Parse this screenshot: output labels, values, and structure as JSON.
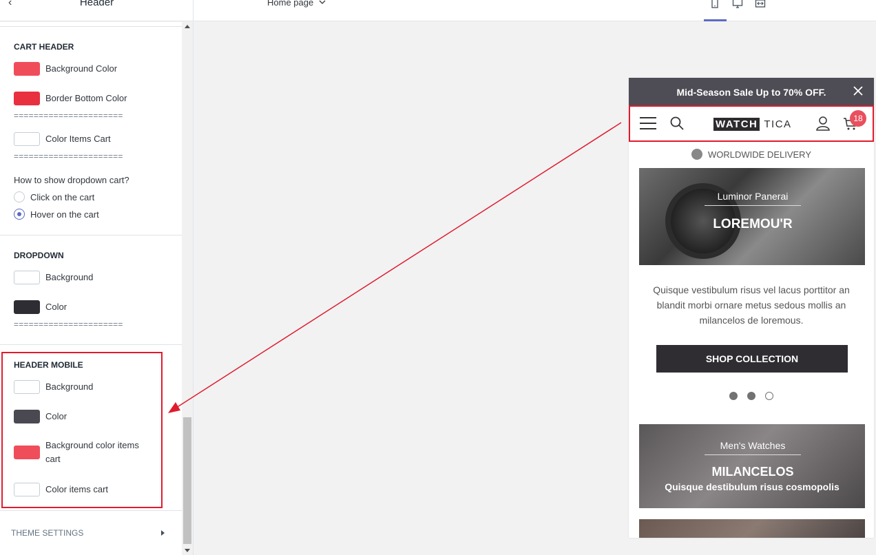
{
  "topbar": {
    "panel_title": "Header",
    "page_selector": "Home page",
    "view_modes": [
      "mobile",
      "desktop",
      "fullscreen"
    ]
  },
  "sidebar": {
    "cart_header": {
      "title": "CART HEADER",
      "background_color_label": "Background Color",
      "background_color": "#f04d5a",
      "border_bottom_label": "Border Bottom Color",
      "border_bottom_color": "#e8303f",
      "separator": "======================",
      "color_items_cart_label": "Color Items Cart",
      "color_items_cart": "#ffffff",
      "dropdown_question": "How to show dropdown cart?",
      "options": [
        "Click on the cart",
        "Hover on the cart"
      ],
      "selected_option": "Hover on the cart"
    },
    "dropdown": {
      "title": "DROPDOWN",
      "background_label": "Background",
      "background_color": "#ffffff",
      "color_label": "Color",
      "color": "#2e2d33",
      "separator": "======================"
    },
    "header_mobile": {
      "title": "HEADER MOBILE",
      "background_label": "Background",
      "background_color": "#ffffff",
      "color_label": "Color",
      "color": "#4a4851",
      "bg_items_cart_label": "Background color items cart",
      "bg_items_cart_color": "#f04d5a",
      "color_items_cart_label": "Color items cart",
      "color_items_cart": "#ffffff"
    },
    "theme_settings": "THEME SETTINGS"
  },
  "preview": {
    "announcement": "Mid-Season Sale Up to 70% OFF.",
    "logo_left": "WATCH",
    "logo_right": "TICA",
    "cart_count": "18",
    "delivery": "WORLDWIDE DELIVERY",
    "slide": {
      "subtitle": "Luminor Panerai",
      "title": "LOREMOU'R"
    },
    "body_text": "Quisque vestibulum risus vel lacus porttitor an blandit morbi ornare metus sedous mollis an milancelos de loremous.",
    "cta": "SHOP COLLECTION",
    "dots": [
      true,
      true,
      false
    ],
    "promo": {
      "subtitle": "Men's Watches",
      "title": "MILANCELOS",
      "description": "Quisque destibulum risus cosmopolis"
    }
  },
  "colors": {
    "accent": "#5c6ac4",
    "highlight": "#e01b2c"
  }
}
